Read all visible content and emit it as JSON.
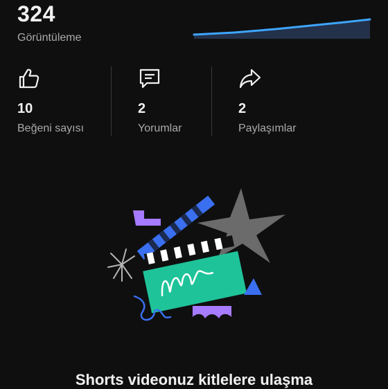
{
  "views": {
    "count": "324",
    "label": "Görüntüleme"
  },
  "stats": [
    {
      "icon": "thumbs-up-icon",
      "count": "10",
      "label": "Beğeni sayısı"
    },
    {
      "icon": "comment-icon",
      "count": "2",
      "label": "Yorumlar"
    },
    {
      "icon": "share-icon",
      "count": "2",
      "label": "Paylaşımlar"
    }
  ],
  "colors": {
    "accent": "#3ea6ff",
    "background": "#0f0f0f",
    "secondary_text": "#aaaaaa"
  },
  "promo": {
    "text": "Shorts videonuz kitlelere ulaşma"
  }
}
